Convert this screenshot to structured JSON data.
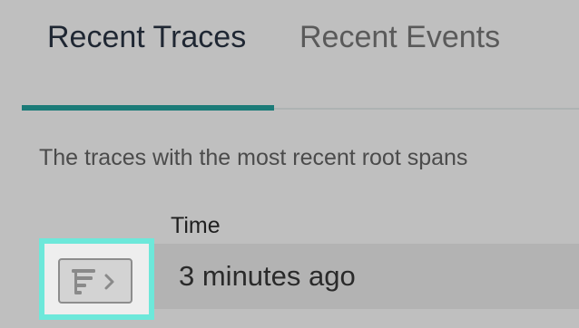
{
  "tabs": [
    {
      "label": "Recent Traces",
      "selected": true
    },
    {
      "label": "Recent Events",
      "selected": false
    }
  ],
  "description": "The traces with the most recent root spans",
  "table": {
    "columns": [
      "Time"
    ],
    "rows": [
      {
        "time": "3 minutes ago",
        "icon": "trace-waterfall-icon"
      }
    ]
  },
  "colors": {
    "accent": "#1b7b78",
    "focus_outline": "#6de8da",
    "background": "#bfbfbf"
  }
}
